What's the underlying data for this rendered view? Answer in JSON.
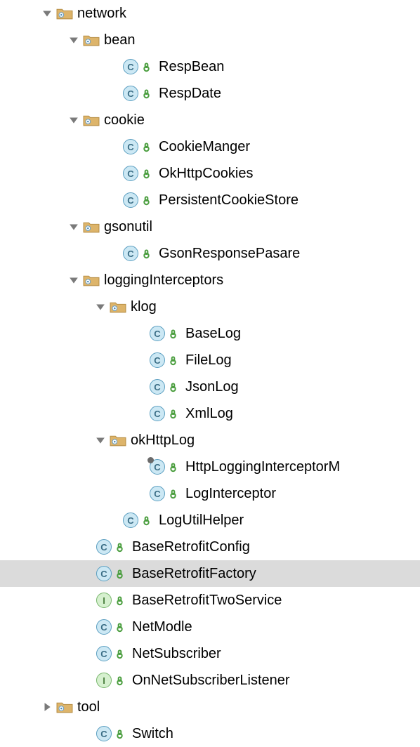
{
  "tree": [
    {
      "depth": 1,
      "expand": "open",
      "kind": "package",
      "label": "network"
    },
    {
      "depth": 2,
      "expand": "open",
      "kind": "package",
      "label": "bean"
    },
    {
      "depth": 3,
      "expand": "none",
      "kind": "class",
      "label": "RespBean"
    },
    {
      "depth": 3,
      "expand": "none",
      "kind": "class",
      "label": "RespDate"
    },
    {
      "depth": 2,
      "expand": "open",
      "kind": "package",
      "label": "cookie"
    },
    {
      "depth": 3,
      "expand": "none",
      "kind": "class",
      "label": "CookieManger"
    },
    {
      "depth": 3,
      "expand": "none",
      "kind": "class",
      "label": "OkHttpCookies"
    },
    {
      "depth": 3,
      "expand": "none",
      "kind": "class",
      "label": "PersistentCookieStore"
    },
    {
      "depth": 2,
      "expand": "open",
      "kind": "package",
      "label": "gsonutil"
    },
    {
      "depth": 3,
      "expand": "none",
      "kind": "class",
      "label": "GsonResponsePasare"
    },
    {
      "depth": 2,
      "expand": "open",
      "kind": "package",
      "label": "loggingInterceptors"
    },
    {
      "depth": 3,
      "expand": "open",
      "kind": "package",
      "label": "klog"
    },
    {
      "depth": 4,
      "expand": "none",
      "kind": "class",
      "label": "BaseLog"
    },
    {
      "depth": 4,
      "expand": "none",
      "kind": "class",
      "label": "FileLog"
    },
    {
      "depth": 4,
      "expand": "none",
      "kind": "class",
      "label": "JsonLog"
    },
    {
      "depth": 4,
      "expand": "none",
      "kind": "class",
      "label": "XmlLog"
    },
    {
      "depth": 3,
      "expand": "open",
      "kind": "package",
      "label": "okHttpLog"
    },
    {
      "depth": 4,
      "expand": "none",
      "kind": "classDecor",
      "label": "HttpLoggingInterceptorM"
    },
    {
      "depth": 4,
      "expand": "none",
      "kind": "class",
      "label": "LogInterceptor"
    },
    {
      "depth": 3,
      "expand": "none",
      "kind": "class",
      "label": "LogUtilHelper"
    },
    {
      "depth": 2,
      "expand": "none",
      "kind": "class",
      "label": "BaseRetrofitConfig"
    },
    {
      "depth": 2,
      "expand": "none",
      "kind": "class",
      "label": "BaseRetrofitFactory",
      "selected": true
    },
    {
      "depth": 2,
      "expand": "none",
      "kind": "interface",
      "label": "BaseRetrofitTwoService"
    },
    {
      "depth": 2,
      "expand": "none",
      "kind": "class",
      "label": "NetModle"
    },
    {
      "depth": 2,
      "expand": "none",
      "kind": "class",
      "label": "NetSubscriber"
    },
    {
      "depth": 2,
      "expand": "none",
      "kind": "interface",
      "label": "OnNetSubscriberListener"
    },
    {
      "depth": 1,
      "expand": "closed",
      "kind": "package",
      "label": "tool"
    },
    {
      "depth": 2,
      "expand": "none",
      "kind": "class",
      "label": "Switch"
    }
  ]
}
